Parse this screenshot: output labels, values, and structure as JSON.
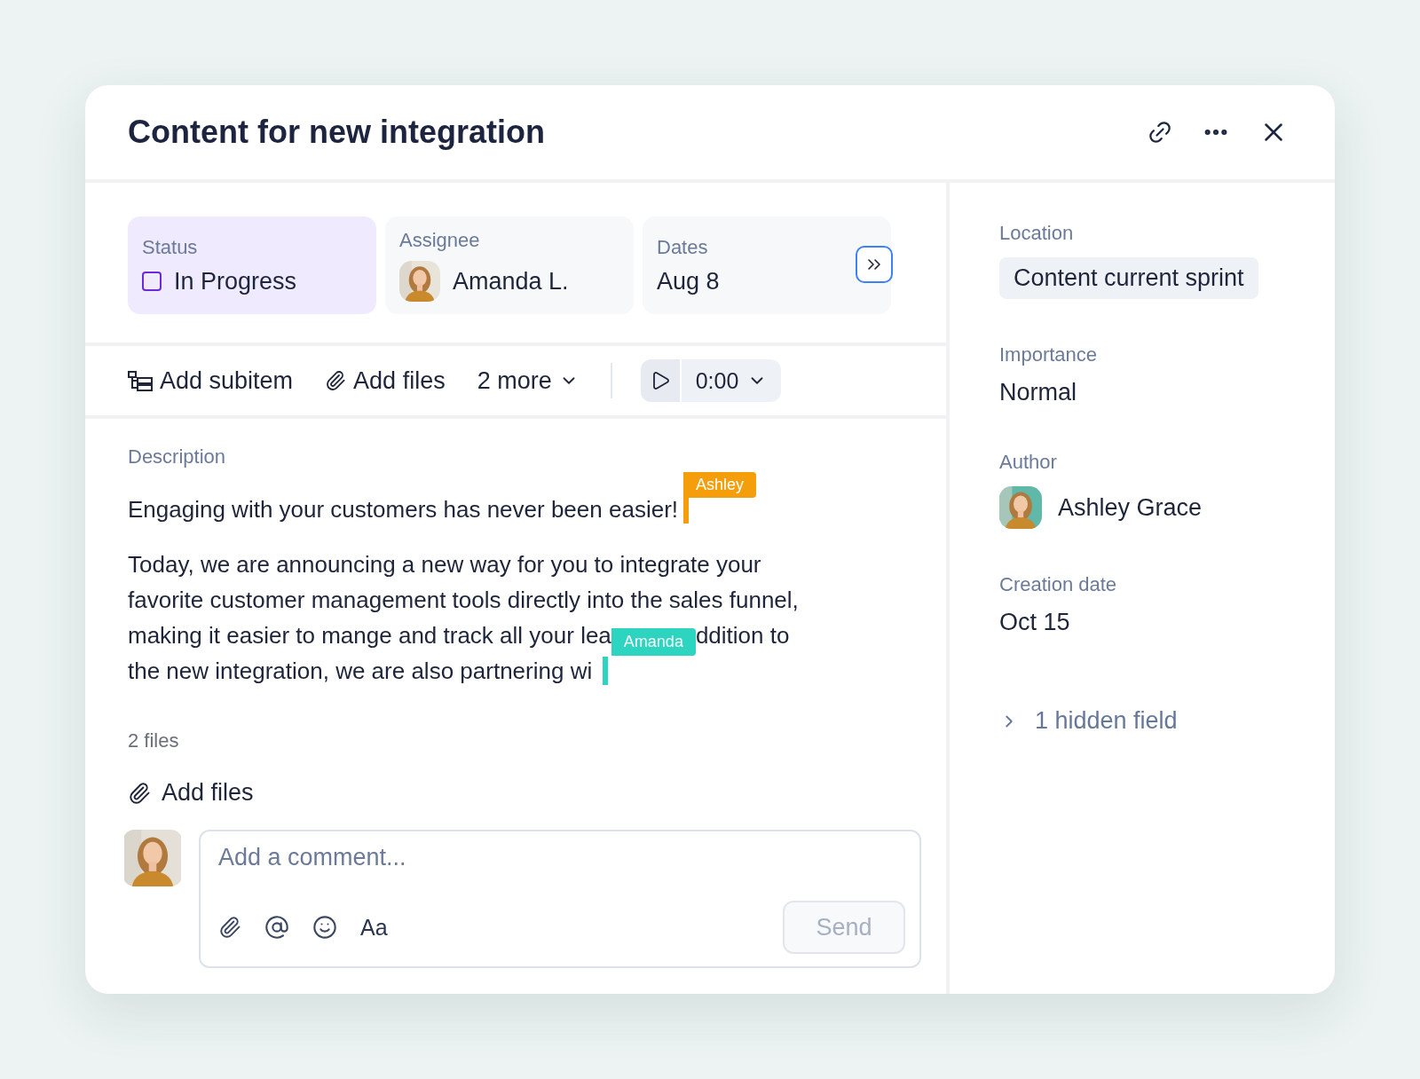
{
  "title": "Content for new integration",
  "fields": [
    {
      "kind": "status",
      "label": "Status",
      "value": "In Progress",
      "selected": true
    },
    {
      "kind": "person",
      "label": "Assignee",
      "value": "Amanda L.",
      "selected": false
    },
    {
      "kind": "date",
      "label": "Dates",
      "value": "Aug 8",
      "selected": false
    }
  ],
  "toolbar": [
    {
      "kind": "subitem",
      "label": "Add subitem"
    },
    {
      "kind": "files",
      "label": "Add files"
    },
    {
      "kind": "more",
      "label": "2 more"
    }
  ],
  "timer": {
    "time": "0:00"
  },
  "description": {
    "label": "Description",
    "paragraphs": [
      {
        "lines": [
          [
            {
              "kind": "text",
              "text": "Engaging with your customers has never been easier!"
            },
            {
              "kind": "cursor",
              "name": "Ashley",
              "color": "#f59e0b"
            }
          ]
        ]
      },
      {
        "lines": [
          [
            {
              "kind": "text",
              "text": "Today, we are announcing a new way for you to integrate your"
            }
          ],
          [
            {
              "kind": "text",
              "text": "favorite customer management tools directly into the sales funnel,"
            }
          ],
          [
            {
              "kind": "text",
              "text": "making it easier to mange and track all your lea"
            },
            {
              "kind": "flag",
              "name": "Amanda",
              "color": "#2dd4bf"
            },
            {
              "kind": "text",
              "text": "ddition to"
            }
          ],
          [
            {
              "kind": "text",
              "text": "the new integration, we are also partnering wi"
            },
            {
              "kind": "caret",
              "color": "#2dd4bf"
            }
          ]
        ]
      }
    ]
  },
  "files": {
    "count": "2 files",
    "add": "Add files"
  },
  "comment": {
    "placeholder": "Add a comment...",
    "format": "Aa",
    "send": {
      "label": "Send",
      "disabled": true
    }
  },
  "sidebar": [
    {
      "kind": "chip",
      "label": "Location",
      "value": "Content current sprint"
    },
    {
      "kind": "text",
      "label": "Importance",
      "value": "Normal"
    },
    {
      "kind": "person",
      "label": "Author",
      "value": "Ashley Grace"
    },
    {
      "kind": "text",
      "label": "Creation date",
      "value": "Oct 15"
    }
  ],
  "hidden": {
    "label": "1 hidden field",
    "expanded": false
  }
}
